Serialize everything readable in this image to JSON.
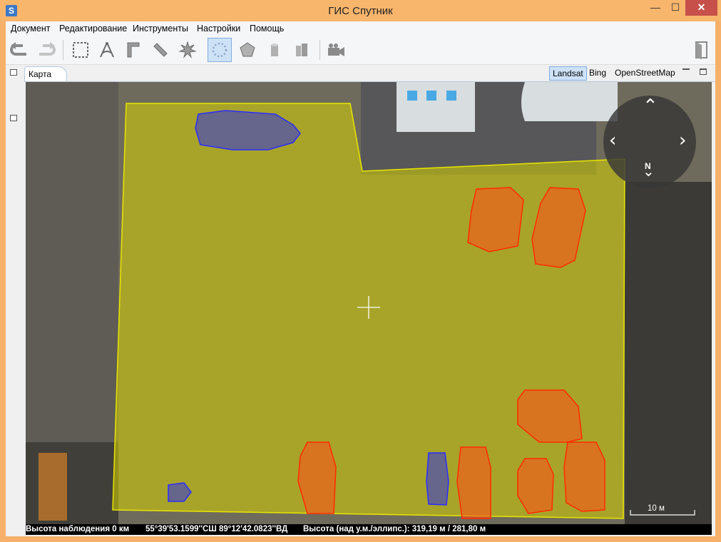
{
  "window": {
    "app_icon_letter": "S",
    "title": "ГИС Спутник",
    "minimize_glyph": "—",
    "maximize_glyph": "☐",
    "close_glyph": "✕"
  },
  "menu": [
    "Документ",
    "Редактирование",
    "Инструменты",
    "Настройки",
    "Помощь"
  ],
  "toolbar": {
    "icons": [
      "undo-icon",
      "redo-icon",
      "select-rectangle-icon",
      "compass-icon",
      "corner-ruler-icon",
      "ruler-icon",
      "star-burst-icon",
      "point-circle-icon",
      "polygon-icon",
      "cylinder-icon",
      "double-cylinder-icon",
      "video-camera-icon",
      "exit-door-icon"
    ],
    "active": "point-circle-icon"
  },
  "tabs": {
    "map_tab": "Карта"
  },
  "layers": {
    "landsat": "Landsat",
    "bing": "Bing",
    "osm": "OpenStreetMap",
    "active": "Landsat"
  },
  "map": {
    "navigator": {
      "north_label": "N"
    },
    "scale_label": "10 м",
    "colors": {
      "area": "#d7d400",
      "vehicle": "#ff4c1a",
      "blue_object": "#3a3ccf"
    }
  },
  "status": {
    "height": "Высота наблюдения 0 км",
    "coords": "55°39'53.1599''СШ 89°12'42.0823''ВД",
    "elevation": "Высота (над у.м./эллипс.): 319,19 м / 281,80 м"
  }
}
